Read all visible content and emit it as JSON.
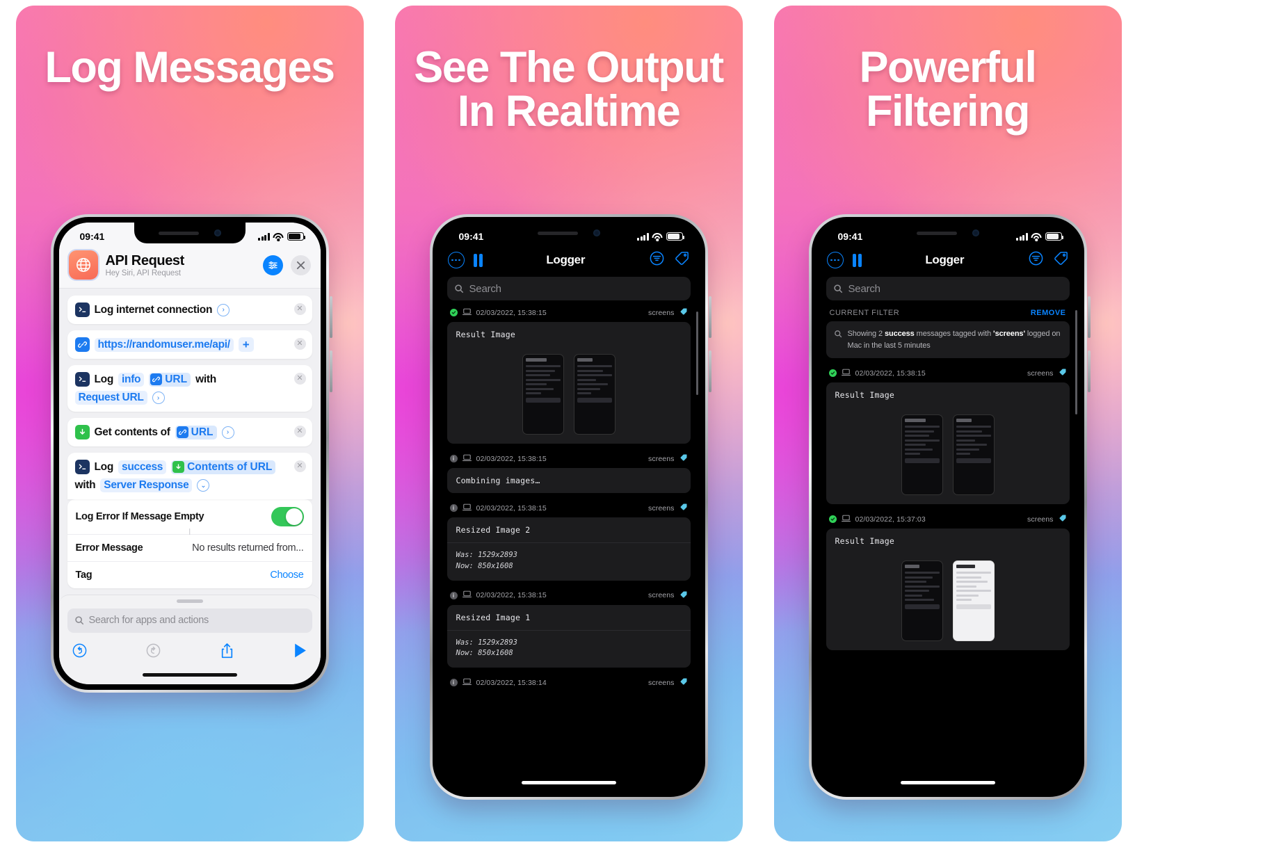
{
  "panels": [
    {
      "headline": "Log Messages",
      "status": {
        "time": "09:41"
      },
      "shortcut": {
        "title": "API Request",
        "subtitle": "Hey Siri, API Request",
        "icon": "globe-icon",
        "actions": [
          {
            "icon": "terminal-icon",
            "parts": [
              {
                "t": "Log internet connection",
                "k": "txt"
              }
            ],
            "chevron": ">"
          },
          {
            "icon": "link-icon",
            "parts": [
              {
                "t": "https://randomuser.me/api/",
                "k": "tok"
              },
              {
                "t": "+",
                "k": "plus"
              }
            ]
          },
          {
            "icon": "terminal-icon",
            "parts": [
              {
                "t": "Log",
                "k": "txt"
              },
              {
                "t": "info",
                "k": "tok"
              },
              {
                "t": "URL",
                "k": "tokico"
              },
              {
                "t": "with",
                "k": "txt"
              },
              {
                "t": "Request URL",
                "k": "tok"
              }
            ],
            "chevron": ">"
          },
          {
            "icon": "download-icon",
            "parts": [
              {
                "t": "Get contents of",
                "k": "txt"
              },
              {
                "t": "URL",
                "k": "tokico"
              }
            ],
            "chevron": ">"
          },
          {
            "icon": "terminal-icon",
            "parts": [
              {
                "t": "Log",
                "k": "txt"
              },
              {
                "t": "success",
                "k": "tok"
              },
              {
                "t": "Contents of URL",
                "k": "tokdl"
              },
              {
                "t": "with",
                "k": "txt"
              },
              {
                "t": "Server Response",
                "k": "tok"
              }
            ],
            "chevron": "v"
          }
        ],
        "settings": [
          {
            "label": "Log Error If Message Empty",
            "control": "toggle",
            "on": true
          },
          {
            "label": "Error Message",
            "value": "No results returned from..."
          },
          {
            "label": "Tag",
            "action": "Choose"
          }
        ],
        "search_placeholder": "Search for apps and actions",
        "toolbar": [
          "undo-icon",
          "redo-icon",
          "share-icon",
          "play-icon"
        ]
      }
    },
    {
      "headline": "See The Output In Realtime",
      "status": {
        "time": "09:41"
      },
      "logger": {
        "title": "Logger",
        "nav_left": [
          "more-circle-icon",
          "pause-icon"
        ],
        "nav_right": [
          "filter-icon",
          "tag-icon"
        ],
        "search_placeholder": "Search",
        "entries": [
          {
            "level": "success",
            "device": "mac-icon",
            "timestamp": "02/03/2022, 15:38:15",
            "tag": "screens",
            "title": "Result Image",
            "type": "images"
          },
          {
            "level": "info",
            "device": "mac-icon",
            "timestamp": "02/03/2022, 15:38:15",
            "tag": "screens",
            "title": "Combining images…",
            "type": "title"
          },
          {
            "level": "info",
            "device": "mac-icon",
            "timestamp": "02/03/2022, 15:38:15",
            "tag": "screens",
            "title": "Resized Image 2",
            "body": "Was: 1529x2893\nNow: 850x1608",
            "type": "body"
          },
          {
            "level": "info",
            "device": "mac-icon",
            "timestamp": "02/03/2022, 15:38:15",
            "tag": "screens",
            "title": "Resized Image 1",
            "body": "Was: 1529x2893\nNow: 850x1608",
            "type": "body"
          },
          {
            "level": "info",
            "device": "mac-icon",
            "timestamp": "02/03/2022, 15:38:14",
            "tag": "screens",
            "title": "",
            "type": "cut"
          }
        ]
      }
    },
    {
      "headline": "Powerful Filtering",
      "status": {
        "time": "09:41"
      },
      "logger": {
        "title": "Logger",
        "nav_left": [
          "more-circle-icon",
          "pause-icon"
        ],
        "nav_right": [
          "filter-icon",
          "tag-icon"
        ],
        "search_placeholder": "Search",
        "filter": {
          "header": "CURRENT FILTER",
          "remove": "REMOVE",
          "text_before": "Showing 2 ",
          "text_bold1": "success",
          "text_mid": " messages tagged with ",
          "text_bold2": "'screens'",
          "text_after": " logged on Mac in the last 5 minutes"
        },
        "entries": [
          {
            "level": "success",
            "device": "mac-icon",
            "timestamp": "02/03/2022, 15:38:15",
            "tag": "screens",
            "title": "Result Image",
            "type": "images"
          },
          {
            "level": "success",
            "device": "mac-icon",
            "timestamp": "02/03/2022, 15:37:03",
            "tag": "screens",
            "title": "Result Image",
            "type": "images2"
          }
        ]
      }
    }
  ]
}
